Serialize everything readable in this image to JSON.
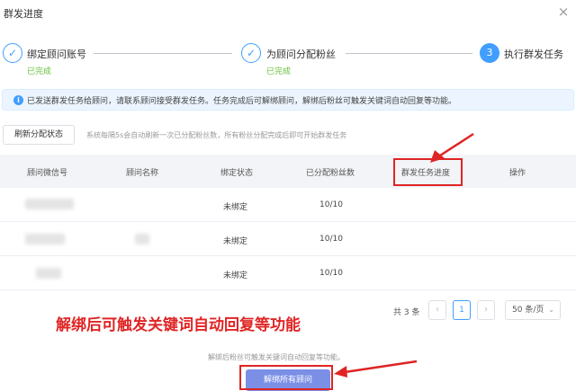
{
  "dialog": {
    "title": "群发进度",
    "close_icon": "×"
  },
  "steps": [
    {
      "label": "绑定顾问账号",
      "status": "已完成",
      "mark": "✓"
    },
    {
      "label": "为顾问分配粉丝",
      "status": "已完成",
      "mark": "✓"
    },
    {
      "label": "执行群发任务",
      "status": "",
      "mark": "3"
    }
  ],
  "alert": {
    "icon": "i",
    "text": "已发送群发任务给顾问，请联系顾问接受群发任务。任务完成后可解绑顾问，解绑后粉丝可触发关键词自动回复等功能。"
  },
  "toolbar": {
    "refresh_label": "刷新分配状态",
    "refresh_hint": "系统每隔5s会自动刷新一次已分配粉丝数，所有粉丝分配完成后即可开始群发任务"
  },
  "table": {
    "headers": [
      "顾问微信号",
      "顾问名称",
      "绑定状态",
      "已分配粉丝数",
      "群发任务进度",
      "操作"
    ],
    "rows": [
      {
        "status": "未绑定",
        "assigned": "10/10"
      },
      {
        "status": "未绑定",
        "assigned": "10/10"
      },
      {
        "status": "未绑定",
        "assigned": "10/10"
      }
    ]
  },
  "pagination": {
    "total": "共 3 条",
    "prev": "‹",
    "current": "1",
    "next": "›",
    "page_size": "50 条/页",
    "caret": "⌄"
  },
  "annotation": {
    "text": "解绑后可触发关键词自动回复等功能",
    "color": "#e02424"
  },
  "footer": {
    "hint": "解绑后粉丝可触发关键词自动回复等功能。",
    "unbind_label": "解绑所有顾问"
  },
  "colors": {
    "accent": "#409eff",
    "success": "#67c23a",
    "annotation": "#e02424",
    "button": "#7b8fe6"
  }
}
